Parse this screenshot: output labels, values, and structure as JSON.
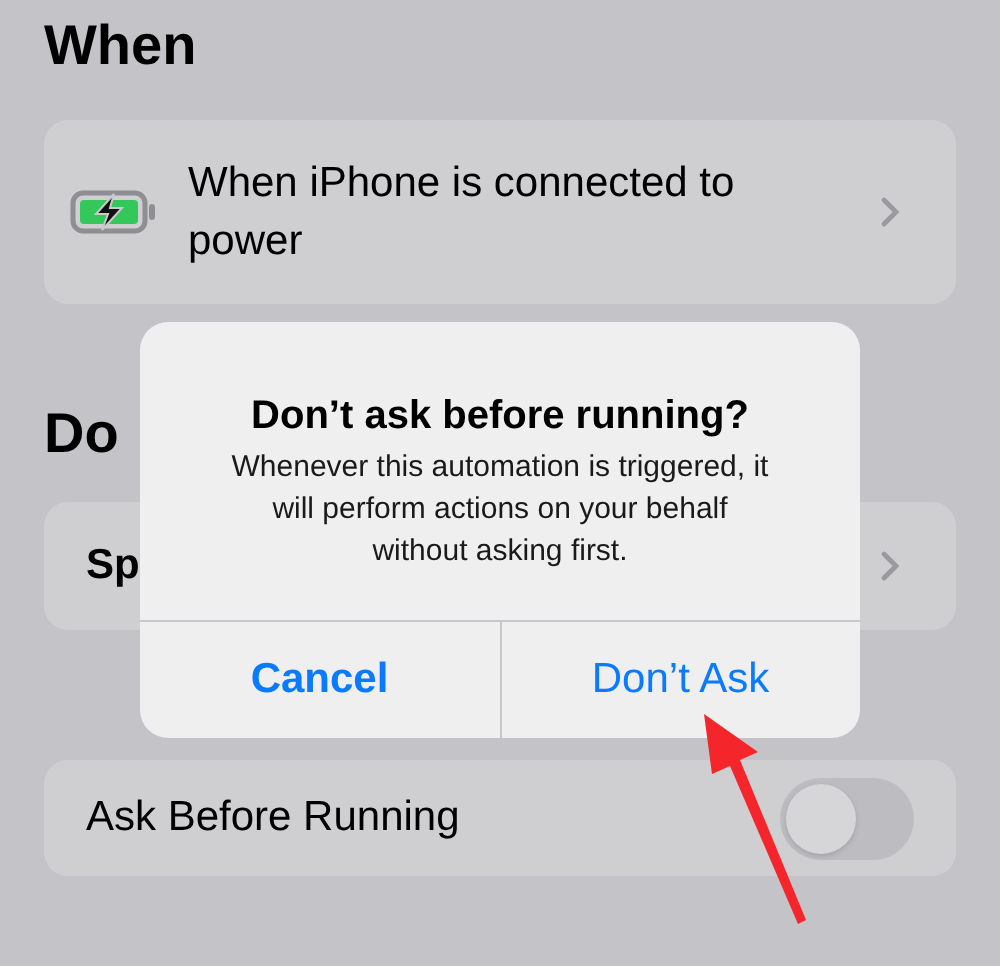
{
  "sections": [
    {
      "heading": "When",
      "row": {
        "kind": "trigger",
        "label": "When iPhone is connected to power"
      }
    },
    {
      "heading": "Do",
      "row": {
        "kind": "action",
        "label": "Sp"
      }
    }
  ],
  "setting": {
    "label": "Ask Before Running",
    "on": false
  },
  "alert": {
    "title": "Don’t ask before running?",
    "message": "Whenever this automation is triggered, it will perform actions on your behalf without asking first.",
    "buttons": [
      {
        "label": "Cancel",
        "kind": "cancel"
      },
      {
        "label": "Don’t Ask",
        "kind": "default"
      }
    ]
  }
}
